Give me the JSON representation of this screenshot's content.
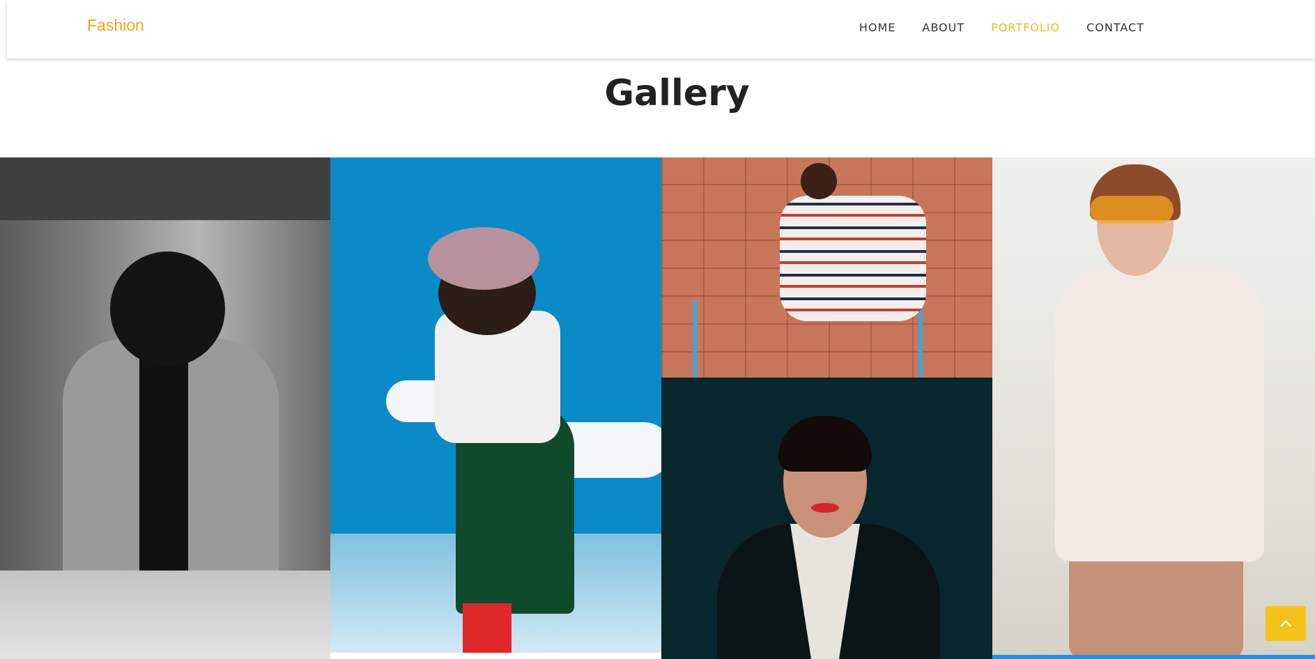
{
  "brand": "Fashion",
  "nav": {
    "items": [
      "HOME",
      "ABOUT",
      "PORTFOLIO",
      "CONTACT"
    ],
    "active": "PORTFOLIO"
  },
  "gallery": {
    "title": "Gallery"
  },
  "icons": {
    "scroll_top": "chevron-up-icon"
  },
  "colors": {
    "brand": "#f5a21b",
    "active_nav": "#f5b71a",
    "scroll_button": "#f5c21b"
  }
}
